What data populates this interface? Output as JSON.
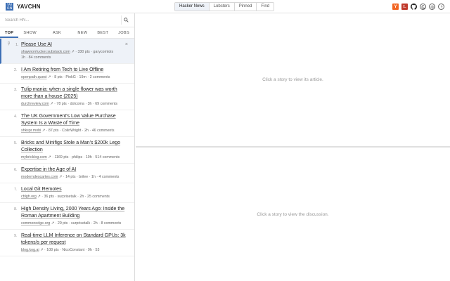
{
  "app": {
    "logo_lines": [
      "YAV",
      "CHN"
    ],
    "name": "YAVCHN"
  },
  "tabs": [
    {
      "label": "Hacker News",
      "active": true
    },
    {
      "label": "Lobsters",
      "active": false
    },
    {
      "label": "Pinned",
      "active": false
    },
    {
      "label": "Find",
      "active": false
    }
  ],
  "header_icons": [
    "y-combinator-icon",
    "lobsters-icon",
    "github-icon",
    "theme-toggle-icon",
    "settings-icon",
    "help-icon"
  ],
  "header_icon_glyphs": {
    "y": "Y",
    "l": "L"
  },
  "search": {
    "placeholder": "Search HN...",
    "value": ""
  },
  "categories": [
    {
      "label": "TOP",
      "active": true
    },
    {
      "label": "SHOW HN",
      "active": false
    },
    {
      "label": "ASK HN",
      "active": false
    },
    {
      "label": "NEW",
      "active": false
    },
    {
      "label": "BEST",
      "active": false
    },
    {
      "label": "JOBS",
      "active": false
    }
  ],
  "stories": [
    {
      "rank": "1.",
      "title": "Please Use AI",
      "domain": "shawnorrtucker.substack.com",
      "arrow": "↗",
      "points": "330 pts",
      "user": "garycomtois",
      "age": "1h",
      "comments": "84 comments",
      "selected": true
    },
    {
      "rank": "2.",
      "title": "I Am Retiring from Tech to Live Offline",
      "domain": "openpath.quest",
      "arrow": "↗",
      "points": "8 pts",
      "user": "PinkG",
      "age": "19m",
      "comments": "2 comments",
      "selected": false
    },
    {
      "rank": "3.",
      "title": "Tulip mania: when a single flower was worth more than a house (2025)",
      "domain": "durchreview.com",
      "arrow": "↗",
      "points": "78 pts",
      "user": "dotcoma",
      "age": "3h",
      "comments": "69 comments",
      "selected": false
    },
    {
      "rank": "4.",
      "title": "The UK Government's Low Value Purchase System Is a Waste of Time",
      "domain": "shkspr.mobi",
      "arrow": "↗",
      "points": "87 pts",
      "user": "ColinWright",
      "age": "2h",
      "comments": "46 comments",
      "selected": false
    },
    {
      "rank": "5.",
      "title": "Bricks and Minifigs Stole a Man's $200k Lego Collection",
      "domain": "mybricklog.com",
      "arrow": "↗",
      "points": "1169 pts",
      "user": "philips",
      "age": "19h",
      "comments": "514 comments",
      "selected": false
    },
    {
      "rank": "6.",
      "title": "Expertise in the Age of AI",
      "domain": "moderndescartes.com",
      "arrow": "↗",
      "points": "14 pts",
      "user": "brilee",
      "age": "1h",
      "comments": "4 comments",
      "selected": false
    },
    {
      "rank": "7.",
      "title": "Local Git Remotes",
      "domain": "cblgh.org",
      "arrow": "↗",
      "points": "36 pts",
      "user": "surprisetalk",
      "age": "2h",
      "comments": "25 comments",
      "selected": false
    },
    {
      "rank": "8.",
      "title": "High Density Living, 2000 Years Ago: Inside the Roman Apartment Building",
      "domain": "commonedge.org",
      "arrow": "↗",
      "points": "29 pts",
      "user": "surprisetalk",
      "age": "2h",
      "comments": "8 comments",
      "selected": false
    },
    {
      "rank": "9.",
      "title": "Real-time LLM Inference on Standard GPUs: 3k tokens/s per request",
      "domain": "blog.kog.ai",
      "arrow": "↗",
      "points": "108 pts",
      "user": "NicoConstant",
      "age": "9h",
      "comments": "53",
      "selected": false
    }
  ],
  "article_hint": "Click a story to view its article.",
  "discussion_hint": "Click a story to view the discussion.",
  "colors": {
    "accent": "#3d6fb5",
    "yc": "#f26522",
    "lobsters": "#c0392b"
  }
}
